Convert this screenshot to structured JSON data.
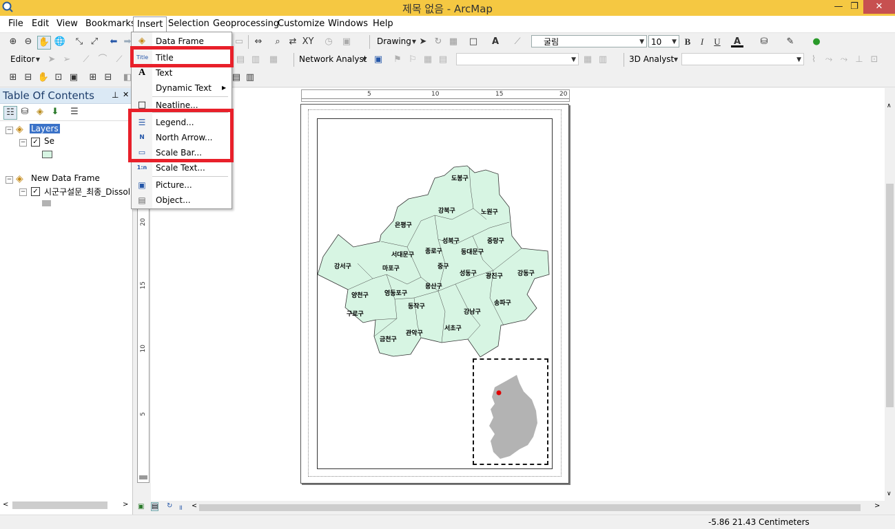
{
  "window": {
    "title": "제목 없음 - ArcMap",
    "minimize": "—",
    "maximize": "❐",
    "close": "✕"
  },
  "menubar": [
    "File",
    "Edit",
    "View",
    "Bookmarks",
    "Insert",
    "Selection",
    "Geoprocessing",
    "Customize",
    "Windows",
    "Help"
  ],
  "toolbar1": {
    "drawing_label": "Drawing",
    "font_name": "굴림",
    "font_size": "10",
    "bold": "B",
    "italic": "I",
    "underline": "U",
    "font_color": "A"
  },
  "toolbar2": {
    "editor_label": "Editor",
    "network_analyst_label": "Network Analyst",
    "analyst_3d_label": "3D Analyst"
  },
  "toc": {
    "title": "Table Of Contents",
    "pin": "ᵖ",
    "close": "✕",
    "frames": [
      {
        "name": "Layers",
        "layer": "Se"
      },
      {
        "name": "New Data Frame",
        "layer": "시군구설문_최종_Dissol"
      }
    ]
  },
  "insert_menu": {
    "items": [
      {
        "label": "Data Frame",
        "icon": "data-frame-icon"
      },
      {
        "label": "Title",
        "icon": "title-icon",
        "icon_text": "Title"
      },
      {
        "label": "Text",
        "icon": "text-icon",
        "icon_text": "A"
      },
      {
        "label": "Dynamic Text",
        "icon": "dynamic-text-icon"
      },
      {
        "label": "Neatline...",
        "icon": "neatline-icon"
      },
      {
        "label": "Legend...",
        "icon": "legend-icon"
      },
      {
        "label": "North Arrow...",
        "icon": "north-arrow-icon",
        "icon_text": "N"
      },
      {
        "label": "Scale Bar...",
        "icon": "scale-bar-icon"
      },
      {
        "label": "Scale Text...",
        "icon": "scale-text-icon",
        "icon_text": "1:n"
      },
      {
        "label": "Picture...",
        "icon": "picture-icon"
      },
      {
        "label": "Object...",
        "icon": "object-icon"
      }
    ],
    "submenu_arrow": "▶"
  },
  "highlight_color": "#e8202a",
  "rulers": {
    "horizontal": [
      "5",
      "10",
      "15",
      "20"
    ],
    "vertical": [
      "20",
      "15",
      "10",
      "5"
    ]
  },
  "map": {
    "districts": [
      "도봉구",
      "강북구",
      "노원구",
      "은평구",
      "성북구",
      "중랑구",
      "종로구",
      "동대문구",
      "서대문구",
      "강서구",
      "마포구",
      "중구",
      "성동구",
      "광진구",
      "강동구",
      "용산구",
      "양천구",
      "영등포구",
      "동작구",
      "강남구",
      "송파구",
      "구로구",
      "서초구",
      "관악구",
      "금천구"
    ],
    "fill_color": "#d7f5e3",
    "inset_fill_color": "#b3b3b3",
    "highlight_color": "#e00000"
  },
  "status": {
    "coords": "-5.86  21.43 Centimeters"
  }
}
